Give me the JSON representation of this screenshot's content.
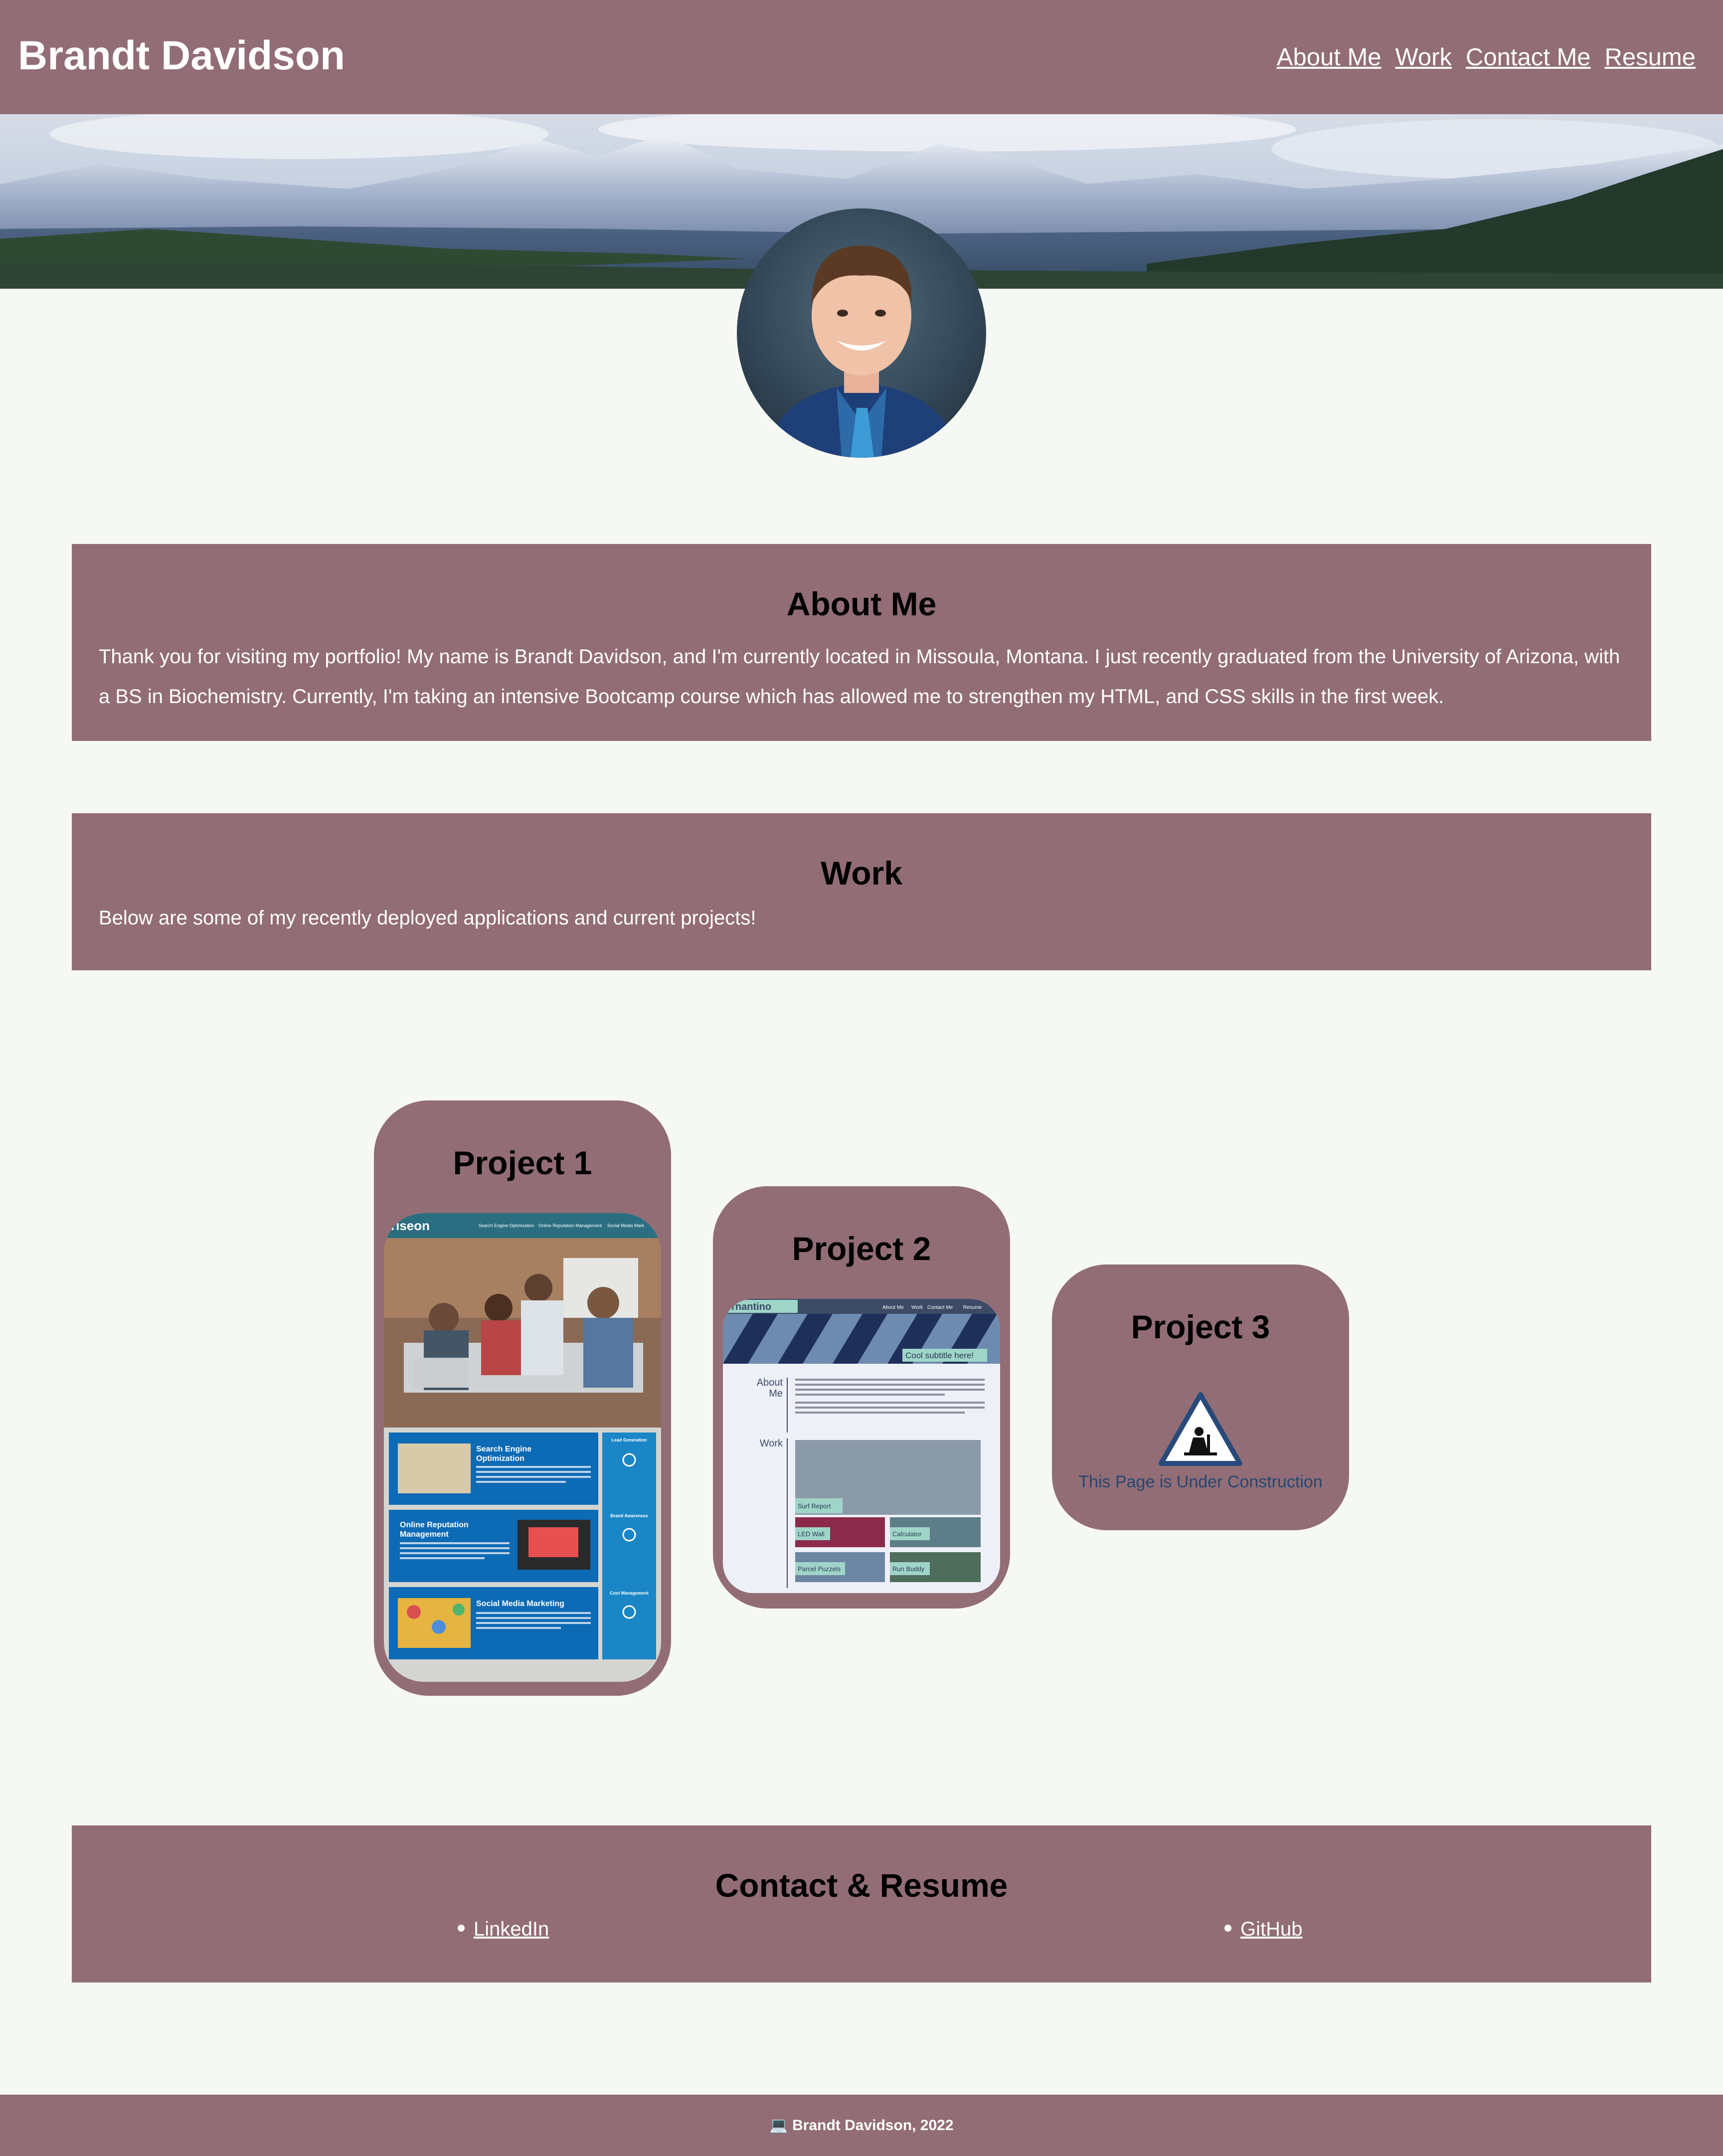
{
  "header": {
    "title": "Brandt Davidson",
    "nav": [
      "About Me",
      "Work",
      "Contact Me",
      "Resume"
    ]
  },
  "about": {
    "heading": "About Me",
    "text": "Thank you for visiting my portfolio! My name is Brandt Davidson, and I'm currently located in Missoula, Montana. I just recently graduated from the University of Arizona, with a BS in Biochemistry. Currently, I'm taking an intensive Bootcamp course which has allowed me to strengthen my HTML, and CSS skills in the first week."
  },
  "work": {
    "heading": "Work",
    "text": "Below are some of my recently deployed applications and current projects!",
    "projects": [
      {
        "title": "Project 1",
        "preview": {
          "brand": "riseon",
          "nav": [
            "Search Engine Optimization",
            "Online Reputation Management",
            "Social Media Mark"
          ],
          "cards": [
            "Search Engine Optimization",
            "Online Reputation Management",
            "Social Media Marketing"
          ],
          "sidebar": [
            "Lead Generation",
            "Brand Awareness",
            "Cost Management"
          ]
        }
      },
      {
        "title": "Project 2",
        "preview": {
          "brand": "ernantino",
          "nav": [
            "About Me",
            "Work",
            "Contact Me",
            "Resume"
          ],
          "subtitle": "Cool subtitle here!",
          "about_label": "About Me",
          "work_label": "Work",
          "tiles": [
            "Surf Report",
            "LED Wall",
            "Calculator",
            "Parcel Puzzels",
            "Run Buddy"
          ]
        }
      },
      {
        "title": "Project 3",
        "notice": "This Page is Under Construction"
      }
    ]
  },
  "contact": {
    "heading": "Contact & Resume",
    "links": [
      "LinkedIn",
      "GitHub"
    ]
  },
  "footer": {
    "icon": "computer-icon",
    "text": "💻 Brandt Davidson, 2022"
  },
  "colors": {
    "accent": "#926d76",
    "background": "#f6f8f4",
    "text_light": "#ffffff"
  }
}
